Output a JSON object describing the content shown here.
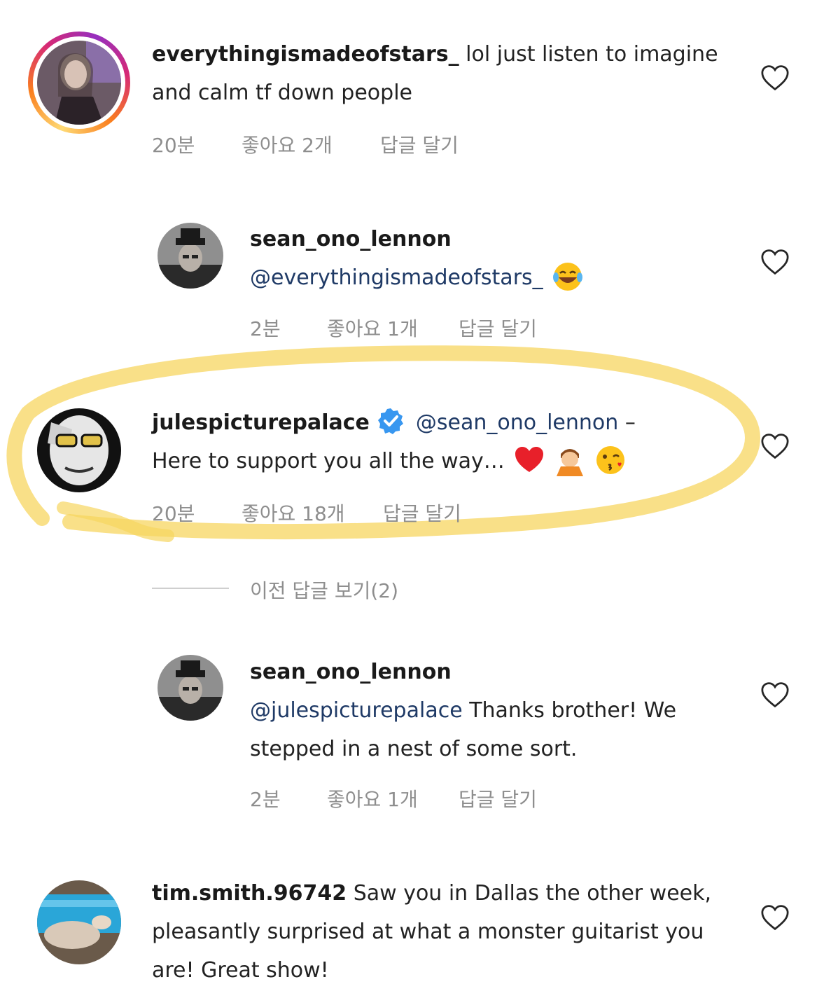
{
  "comments": [
    {
      "username": "everythingismadeofstars_",
      "text": " lol just listen to imagine and calm tf down people",
      "time": "20분",
      "likes": "좋아요 2개",
      "reply": "답글 달기"
    },
    {
      "username": "sean_ono_lennon",
      "mention": "@everythingismadeofstars_",
      "time": "2분",
      "likes": "좋아요 1개",
      "reply": "답글 달기"
    },
    {
      "username": "julespicturepalace",
      "mention": "@sean_ono_lennon",
      "text_line1_suffix": " –",
      "text_line2": "Here to support you all the way…",
      "time": "20분",
      "likes": "좋아요 18개",
      "reply": "답글 달기"
    },
    {
      "username": "sean_ono_lennon",
      "mention": "@julespicturepalace",
      "text": " Thanks brother! We stepped in a nest of some sort.",
      "time": "2분",
      "likes": "좋아요 1개",
      "reply": "답글 달기"
    },
    {
      "username": "tim.smith.96742",
      "text": " Saw you in Dallas the other week, pleasantly surprised at what a monster guitarist you are! Great show!"
    }
  ],
  "view_previous_replies": "이전 답글 보기(2)",
  "colors": {
    "highlight": "#f7d560",
    "verified": "#3897f0",
    "mention": "#1f3a66",
    "meta": "#8e8e8e"
  },
  "icons": [
    "heart-outline-icon",
    "verified-badge-icon",
    "laughing-tears-emoji",
    "red-heart-emoji",
    "praying-person-emoji",
    "kissing-face-emoji"
  ]
}
